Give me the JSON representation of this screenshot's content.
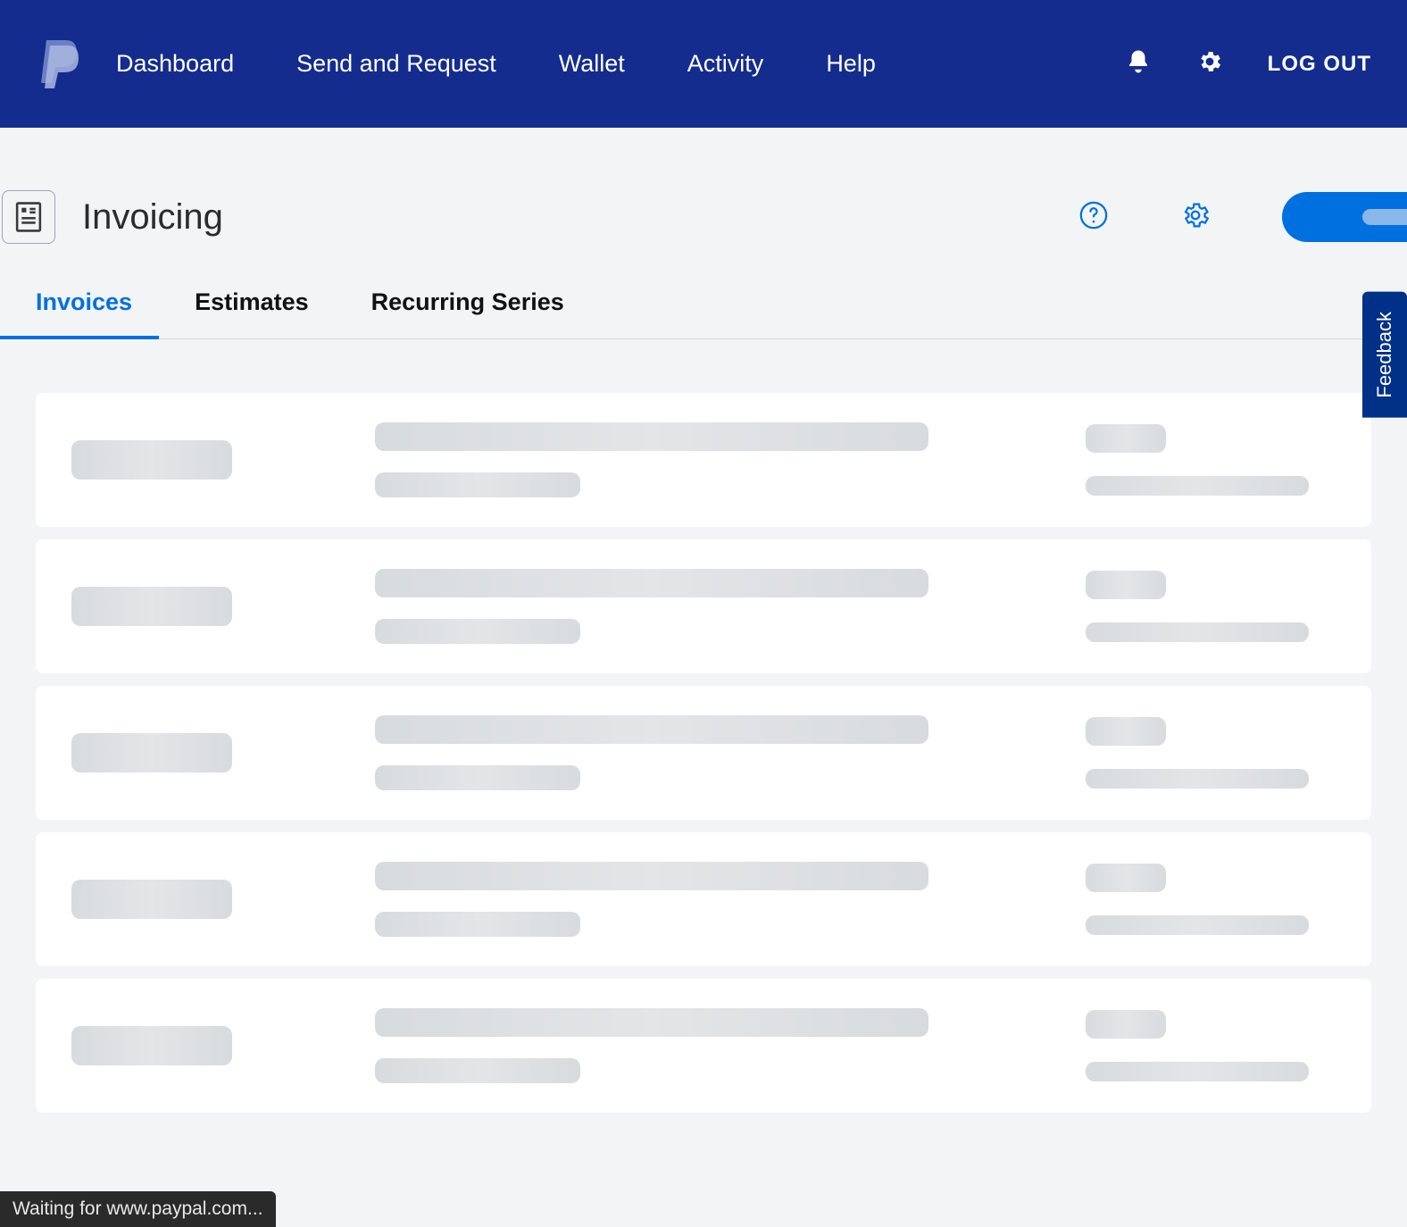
{
  "header": {
    "nav": [
      {
        "label": "Dashboard"
      },
      {
        "label": "Send and Request"
      },
      {
        "label": "Wallet"
      },
      {
        "label": "Activity"
      },
      {
        "label": "Help"
      }
    ],
    "logout": "LOG OUT"
  },
  "page": {
    "title": "Invoicing"
  },
  "tabs": [
    {
      "label": "Invoices",
      "active": true
    },
    {
      "label": "Estimates",
      "active": false
    },
    {
      "label": "Recurring Series",
      "active": false
    }
  ],
  "feedback": {
    "label": "Feedback"
  },
  "statusbar": {
    "text": "Waiting for www.paypal.com..."
  },
  "skeleton_rows": 5
}
